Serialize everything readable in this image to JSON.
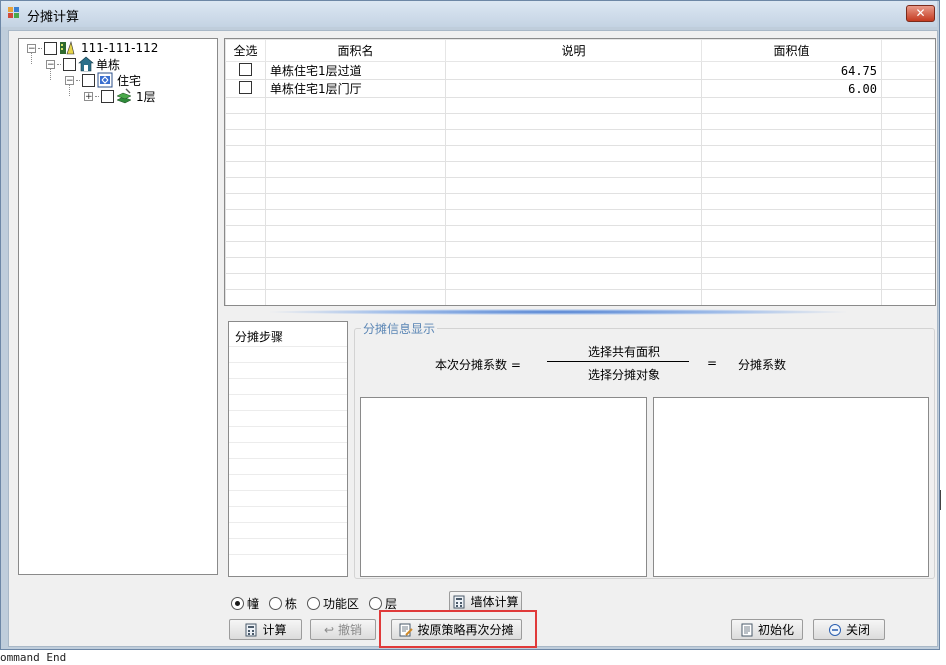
{
  "window": {
    "title": "分摊计算",
    "close_glyph": "✕"
  },
  "tree": {
    "nodes": [
      {
        "label": "111-111-112",
        "icon": "building-lot-icon",
        "expander": "−"
      },
      {
        "label": "单栋",
        "icon": "house-icon",
        "expander": "−"
      },
      {
        "label": "住宅",
        "icon": "residence-icon",
        "expander": "−"
      },
      {
        "label": "1层",
        "icon": "floor-icon",
        "expander": "+"
      }
    ]
  },
  "grid": {
    "headers": {
      "select_all": "全选",
      "area_name": "面积名",
      "description": "说明",
      "area_value": "面积值"
    },
    "rows": [
      {
        "name": "单栋住宅1层过道",
        "description": "",
        "value": "64.75"
      },
      {
        "name": "单栋住宅1层门厅",
        "description": "",
        "value": "6.00"
      }
    ]
  },
  "steps": {
    "header": "分摊步骤"
  },
  "info": {
    "legend": "分摊信息显示",
    "lhs": "本次分摊系数 =",
    "numerator": "选择共有面积",
    "denominator": "选择分摊对象",
    "equals": "=",
    "rhs": "分摊系数"
  },
  "radios": [
    {
      "label": "幢",
      "checked": true
    },
    {
      "label": "栋",
      "checked": false
    },
    {
      "label": "功能区",
      "checked": false
    },
    {
      "label": "层",
      "checked": false
    }
  ],
  "buttons": {
    "wall_calc": "墙体计算",
    "calculate": "计算",
    "undo": "撤销",
    "reapportion": "按原策略再次分摊",
    "initialize": "初始化",
    "close": "关闭"
  },
  "footer": "ommand End",
  "colors": {
    "highlight": "#e03a3a",
    "legend_text": "#5b86b5"
  }
}
